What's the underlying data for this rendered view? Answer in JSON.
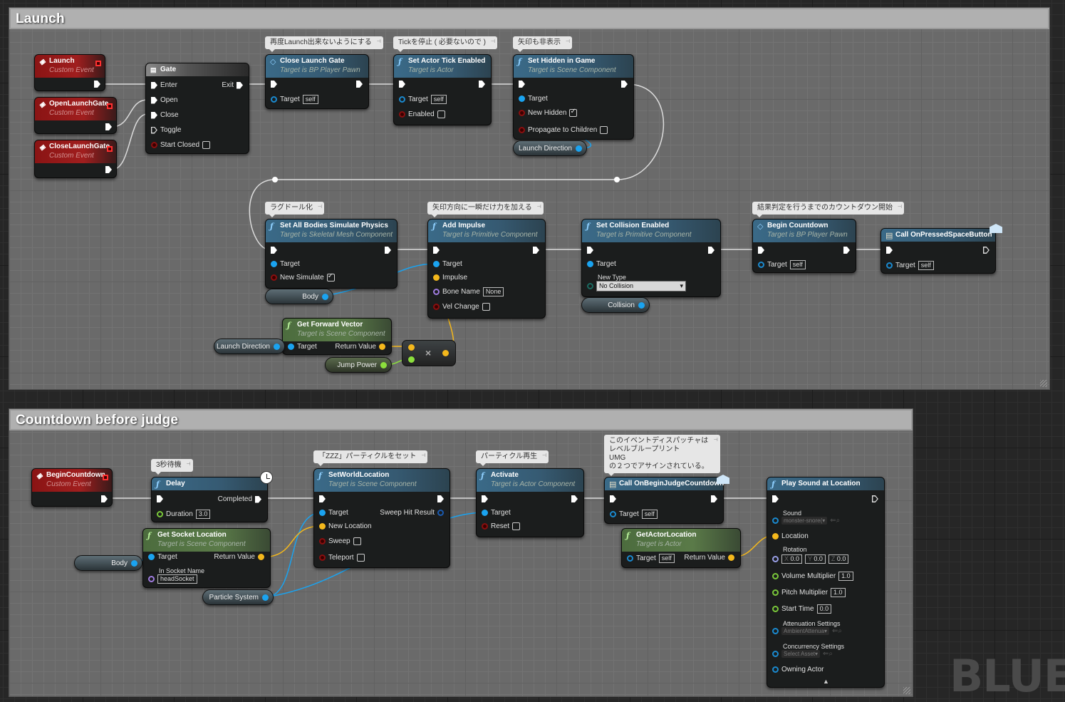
{
  "watermark": "BLUEP",
  "comments": [
    {
      "title": "Launch"
    },
    {
      "title": "Countdown before judge"
    }
  ],
  "bubbles": {
    "close_gate": "再度Launch出来ないようにする",
    "tick": "Tickを停止 ( 必要ないので )",
    "hidden": "矢印も非表示",
    "ragdoll": "ラグドール化",
    "impulse": "矢印方向に一瞬だけ力を加える",
    "countdown": "結果判定を行うまでのカウントダウン開始",
    "delay": "3秒待機",
    "setloc": "「ZZZ」パーティクルをセット",
    "activate": "パーティクル再生",
    "dispatcher": "このイベントディスパッチャは\nレベルブループリント\nUMG\nの２つでアサインされている。"
  },
  "nodes": {
    "launch": {
      "title": "Launch",
      "subtitle": "Custom Event"
    },
    "open_gate": {
      "title": "OpenLaunchGate",
      "subtitle": "Custom Event"
    },
    "close_gate_ev": {
      "title": "CloseLaunchGate",
      "subtitle": "Custom Event"
    },
    "gate": {
      "title": "Gate",
      "pins": [
        "Enter",
        "Open",
        "Close",
        "Toggle",
        "Start Closed"
      ],
      "exit": "Exit"
    },
    "close_launch_gate": {
      "title": "Close Launch Gate",
      "subtitle": "Target is BP Player Pawn",
      "target": "Target",
      "target_val": "self"
    },
    "tick_enabled": {
      "title": "Set Actor Tick Enabled",
      "subtitle": "Target is Actor",
      "target": "Target",
      "target_val": "self",
      "enabled": "Enabled"
    },
    "hidden_game": {
      "title": "Set Hidden in Game",
      "subtitle": "Target is Scene Component",
      "target": "Target",
      "new_hidden": "New Hidden",
      "propagate": "Propagate to Children"
    },
    "simulate": {
      "title": "Set All Bodies Simulate Physics",
      "subtitle": "Target is Skeletal Mesh Component",
      "target": "Target",
      "new_simulate": "New Simulate"
    },
    "impulse": {
      "title": "Add Impulse",
      "subtitle": "Target is Primitive Component",
      "target": "Target",
      "impulse": "Impulse",
      "bone": "Bone Name",
      "bone_val": "None",
      "vel": "Vel Change"
    },
    "collision": {
      "title": "Set Collision Enabled",
      "subtitle": "Target is Primitive Component",
      "target": "Target",
      "new_type": "New Type",
      "new_type_val": "No Collision"
    },
    "begin_countdown": {
      "title": "Begin Countdown",
      "subtitle": "Target is BP Player Pawn",
      "target": "Target",
      "target_val": "self"
    },
    "call_space": {
      "title": "Call OnPressedSpaceButton",
      "target": "Target",
      "target_val": "self"
    },
    "forward": {
      "title": "Get Forward Vector",
      "subtitle": "Target is Scene Component",
      "target": "Target",
      "ret": "Return Value"
    },
    "multiply": {
      "symbol": "×"
    },
    "bc_event": {
      "title": "BeginCountdown",
      "subtitle": "Custom Event"
    },
    "delay": {
      "title": "Delay",
      "completed": "Completed",
      "duration": "Duration",
      "duration_val": "3.0"
    },
    "socket": {
      "title": "Get Socket Location",
      "subtitle": "Target is Scene Component",
      "target": "Target",
      "ret": "Return Value",
      "socket": "In Socket Name",
      "socket_val": "headSocket"
    },
    "setworld": {
      "title": "SetWorldLocation",
      "subtitle": "Target is Scene Component",
      "target": "Target",
      "sweep_hit": "Sweep Hit Result",
      "new_loc": "New Location",
      "sweep": "Sweep",
      "teleport": "Teleport"
    },
    "activate": {
      "title": "Activate",
      "subtitle": "Target is Actor Component",
      "target": "Target",
      "reset": "Reset"
    },
    "call_judge": {
      "title": "Call OnBeginJudgeCountdown",
      "target": "Target",
      "target_val": "self"
    },
    "actorloc": {
      "title": "GetActorLocation",
      "subtitle": "Target is Actor",
      "target": "Target",
      "target_val": "self",
      "ret": "Return Value"
    },
    "playsound": {
      "title": "Play Sound at Location",
      "sound": "Sound",
      "sound_val": "monster-snore(",
      "location": "Location",
      "rotation": "Rotation",
      "rx": "0.0",
      "ry": "0.0",
      "rz": "0.0",
      "volume": "Volume Multiplier",
      "volume_val": "1.0",
      "pitch": "Pitch Multiplier",
      "pitch_val": "1.0",
      "start": "Start Time",
      "start_val": "0.0",
      "atten": "Attenuation Settings",
      "atten_val": "AmbientAttenua",
      "concur": "Concurrency Settings",
      "concur_val": "Select Asset",
      "owning": "Owning Actor"
    }
  },
  "vars": {
    "launch_dir": "Launch Direction",
    "body": "Body",
    "collision": "Collision",
    "launch_dir2": "Launch Direction",
    "jump": "Jump Power",
    "body2": "Body",
    "particle": "Particle System"
  }
}
